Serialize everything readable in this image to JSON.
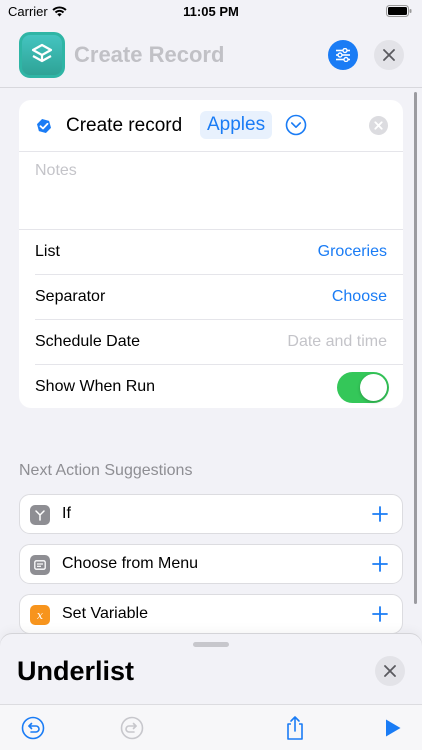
{
  "status": {
    "carrier": "Carrier",
    "time": "11:05 PM"
  },
  "header": {
    "title": "Create Record"
  },
  "action": {
    "label": "Create record",
    "token": "Apples",
    "notes_placeholder": "Notes"
  },
  "params": [
    {
      "label": "List",
      "value": "Groceries",
      "placeholder": false
    },
    {
      "label": "Separator",
      "value": "Choose",
      "placeholder": false
    },
    {
      "label": "Schedule Date",
      "value": "Date and time",
      "placeholder": true
    },
    {
      "label": "Show When Run",
      "toggle": true
    }
  ],
  "suggestions": {
    "title": "Next Action Suggestions",
    "items": [
      {
        "label": "If",
        "icon": "branch-icon",
        "color": "#8e8e93"
      },
      {
        "label": "Choose from Menu",
        "icon": "menu-icon",
        "color": "#8e8e93"
      },
      {
        "label": "Set Variable",
        "icon": "variable-icon",
        "color": "#f7941d"
      }
    ]
  },
  "sheet": {
    "title": "Underlist"
  },
  "colors": {
    "accent": "#1a7cf5",
    "toggle_on": "#34c759",
    "app_icon": "#2fb5a5"
  }
}
